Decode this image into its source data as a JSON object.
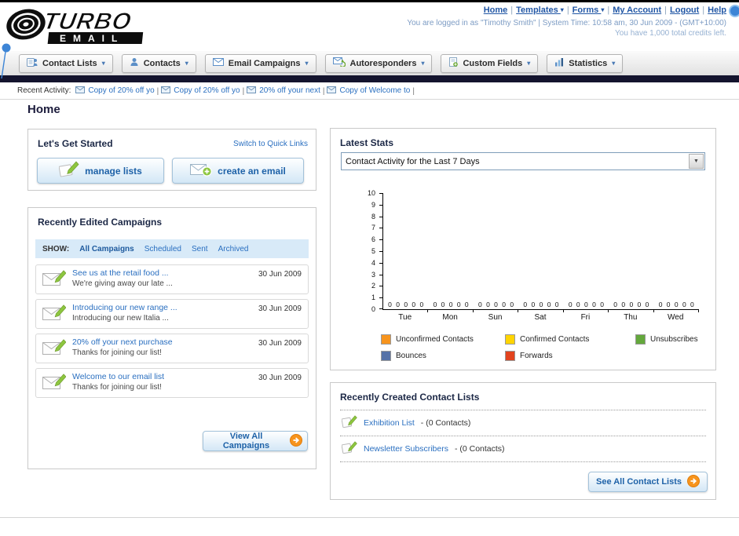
{
  "page": {
    "title": "Home"
  },
  "header": {
    "logo_line1": "TURBO",
    "logo_line2": "EMAIL",
    "nav_links": [
      {
        "label": "Home",
        "dropdown": false
      },
      {
        "label": "Templates",
        "dropdown": true
      },
      {
        "label": "Forms",
        "dropdown": true
      },
      {
        "label": "My Account",
        "dropdown": false
      },
      {
        "label": "Logout",
        "dropdown": false
      },
      {
        "label": "Help",
        "dropdown": false
      }
    ],
    "session_info": "You are logged in as \"Timothy Smith\" | System Time: 10:58 am, 30 Jun 2009 - (GMT+10:00)",
    "credits_info": "You have 1,000 total credits left."
  },
  "main_nav": {
    "tabs": [
      {
        "label": "Contact Lists",
        "icon": "contact-lists-icon"
      },
      {
        "label": "Contacts",
        "icon": "contacts-icon"
      },
      {
        "label": "Email Campaigns",
        "icon": "email-campaigns-icon"
      },
      {
        "label": "Autoresponders",
        "icon": "autoresponders-icon"
      },
      {
        "label": "Custom Fields",
        "icon": "custom-fields-icon"
      },
      {
        "label": "Statistics",
        "icon": "statistics-icon"
      }
    ]
  },
  "recent_activity": {
    "label": "Recent Activity:",
    "items": [
      {
        "label": "Copy of 20% off yo"
      },
      {
        "label": "Copy of 20% off yo"
      },
      {
        "label": "20% off your next"
      },
      {
        "label": "Copy of Welcome to"
      }
    ]
  },
  "get_started": {
    "title": "Let's Get Started",
    "switch_link": "Switch to Quick Links",
    "manage_lists_label": "manage lists",
    "create_email_label": "create an email"
  },
  "campaigns": {
    "title": "Recently Edited Campaigns",
    "show_label": "SHOW:",
    "filters": [
      "All Campaigns",
      "Scheduled",
      "Sent",
      "Archived"
    ],
    "active_filter": "All Campaigns",
    "items": [
      {
        "title": "See us at the retail food ...",
        "subtitle": "We're giving away our late ...",
        "date": "30 Jun 2009"
      },
      {
        "title": "Introducing our new range ...",
        "subtitle": "Introducing our new Italia ...",
        "date": "30 Jun 2009"
      },
      {
        "title": "20% off your next purchase",
        "subtitle": "Thanks for joining our list!",
        "date": "30 Jun 2009"
      },
      {
        "title": "Welcome to our email list",
        "subtitle": "Thanks for joining our list!",
        "date": "30 Jun 2009"
      }
    ],
    "view_all_label": "View All Campaigns"
  },
  "stats": {
    "title": "Latest Stats",
    "dropdown_value": "Contact Activity for the Last 7 Days"
  },
  "chart_data": {
    "type": "bar",
    "title": "Contact Activity for the Last 7 Days",
    "categories": [
      "Tue",
      "Mon",
      "Sun",
      "Sat",
      "Fri",
      "Thu",
      "Wed"
    ],
    "series": [
      {
        "name": "Unconfirmed Contacts",
        "color": "#f7941d",
        "values": [
          0,
          0,
          0,
          0,
          0,
          0,
          0
        ]
      },
      {
        "name": "Confirmed Contacts",
        "color": "#ffd400",
        "values": [
          0,
          0,
          0,
          0,
          0,
          0,
          0
        ]
      },
      {
        "name": "Unsubscribes",
        "color": "#64a83c",
        "values": [
          0,
          0,
          0,
          0,
          0,
          0,
          0
        ]
      },
      {
        "name": "Bounces",
        "color": "#5572a7",
        "values": [
          0,
          0,
          0,
          0,
          0,
          0,
          0
        ]
      },
      {
        "name": "Forwards",
        "color": "#e2431e",
        "values": [
          0,
          0,
          0,
          0,
          0,
          0,
          0
        ]
      }
    ],
    "ylim": [
      0,
      10
    ],
    "y_ticks": [
      0,
      1,
      2,
      3,
      4,
      5,
      6,
      7,
      8,
      9,
      10
    ],
    "grid": false,
    "legend_position": "bottom"
  },
  "contact_lists": {
    "title": "Recently Created Contact Lists",
    "items": [
      {
        "name": "Exhibition List",
        "detail": "- (0 Contacts)"
      },
      {
        "name": "Newsletter Subscribers",
        "detail": "- (0 Contacts)"
      }
    ],
    "see_all_label": "See All Contact Lists"
  }
}
